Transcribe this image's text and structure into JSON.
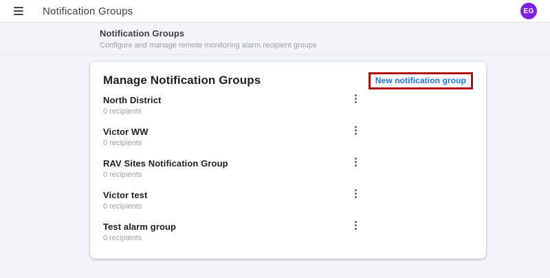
{
  "appbar": {
    "title": "Notification Groups",
    "avatar_initials": "EG"
  },
  "subheader": {
    "title": "Notification Groups",
    "subtitle": "Configure and manage remote monitoring alarm recipient groups"
  },
  "card": {
    "title": "Manage Notification Groups",
    "new_button_label": "New notification group",
    "groups": [
      {
        "name": "North District",
        "recipients": "0 recipients"
      },
      {
        "name": "Victor WW",
        "recipients": "0 recipients"
      },
      {
        "name": "RAV Sites Notification Group",
        "recipients": "0 recipients"
      },
      {
        "name": "Victor test",
        "recipients": "0 recipients"
      },
      {
        "name": "Test alarm group",
        "recipients": "0 recipients"
      }
    ]
  },
  "icons": {
    "hamburger": "menu-icon",
    "kebab": "vertical-dots-menu-icon"
  },
  "colors": {
    "accent_blue": "#1a73e8",
    "avatar_purple": "#7d23e1",
    "annotation_red": "#b11212",
    "page_bg": "#f2f4f7"
  }
}
